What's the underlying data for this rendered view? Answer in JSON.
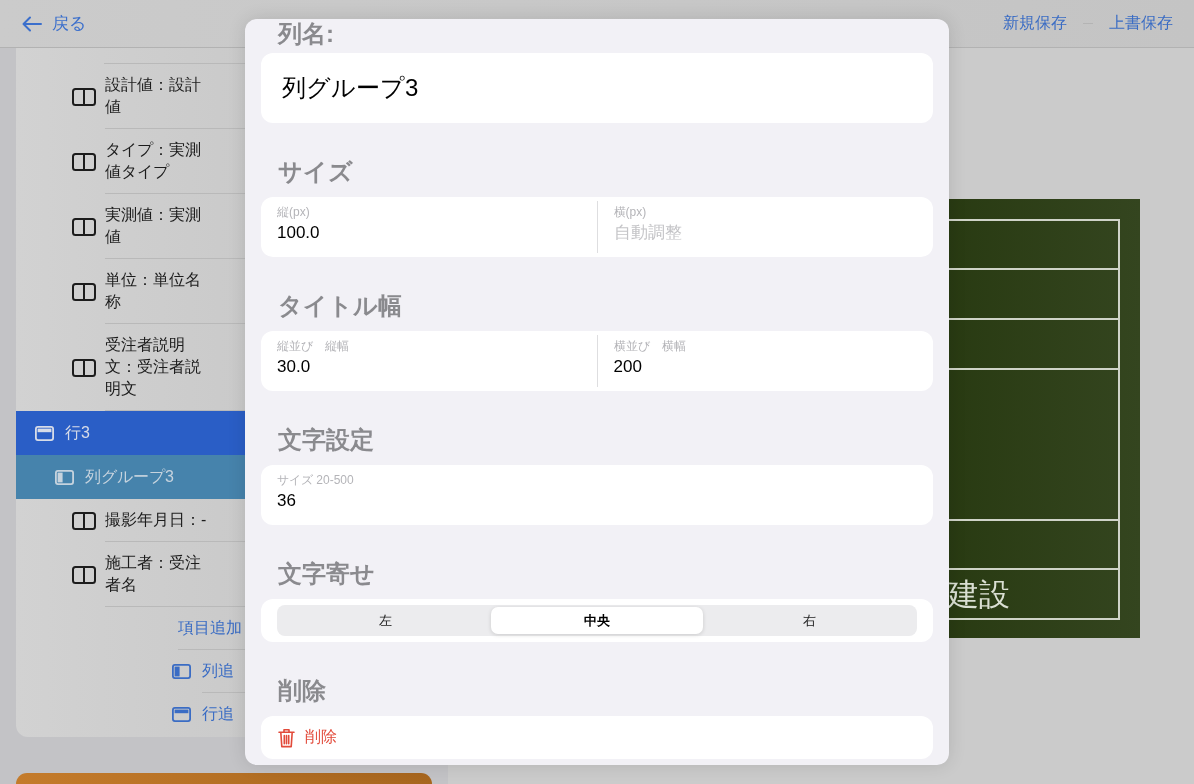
{
  "nav": {
    "back": "戻る",
    "actions": [
      "新規保存",
      "上書保存"
    ]
  },
  "tree": [
    {
      "kind": "cell",
      "label": "設計値：設計値",
      "selected": false
    },
    {
      "kind": "cell",
      "label": "タイプ：実測値タイプ",
      "selected": false
    },
    {
      "kind": "cell",
      "label": "実測値：実測値",
      "selected": false
    },
    {
      "kind": "cell",
      "label": "単位：単位名称",
      "selected": false
    },
    {
      "kind": "cell",
      "label": "受注者説明文：受注者説明文",
      "selected": false
    },
    {
      "kind": "row",
      "label": "行3",
      "selected": true,
      "children": [
        {
          "kind": "group",
          "label": "列グループ3",
          "selected": true,
          "children": [
            {
              "kind": "cell",
              "label": "撮影年月日：-",
              "selected": false
            },
            {
              "kind": "cell",
              "label": "施工者：受注者名",
              "selected": false
            }
          ]
        }
      ]
    }
  ],
  "tree_actions": [
    {
      "kind": "item",
      "label": "項目追加"
    },
    {
      "kind": "column",
      "label": "列追"
    },
    {
      "kind": "row",
      "label": "行追"
    }
  ],
  "board": {
    "bottom_row": "建設"
  },
  "sheet": {
    "sections": [
      {
        "kind": "text",
        "title": "列名:",
        "fields": [
          {
            "value": "列グループ3"
          }
        ]
      },
      {
        "kind": "fields",
        "title": "サイズ",
        "fields": [
          {
            "label": "縦(px)",
            "value": "100.0"
          },
          {
            "label": "横(px)",
            "placeholder": "自動調整"
          }
        ]
      },
      {
        "kind": "fields",
        "title": "タイトル幅",
        "fields": [
          {
            "label": "縦並び　縦幅",
            "value": "30.0"
          },
          {
            "label": "横並び　横幅",
            "value": "200"
          }
        ]
      },
      {
        "kind": "fields",
        "title": "文字設定",
        "fields": [
          {
            "label": "サイズ 20-500",
            "value": "36"
          }
        ]
      },
      {
        "kind": "segmented",
        "title": "文字寄せ",
        "options": [
          {
            "label": "左",
            "selected": false
          },
          {
            "label": "中央",
            "selected": true
          },
          {
            "label": "右",
            "selected": false
          }
        ]
      },
      {
        "kind": "delete",
        "title": "削除",
        "button": "削除"
      }
    ]
  }
}
